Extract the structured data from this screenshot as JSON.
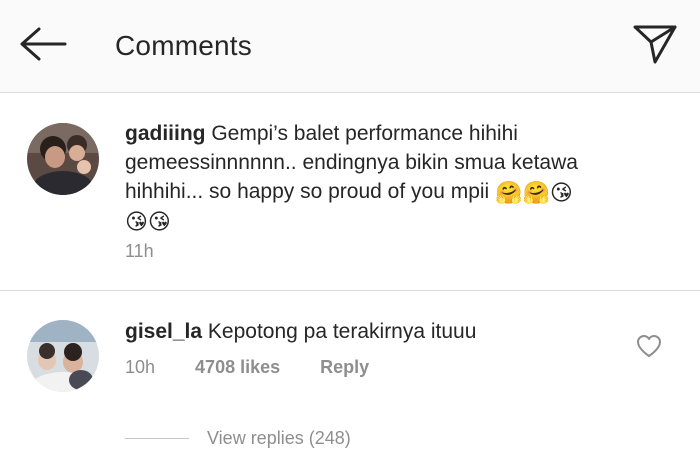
{
  "header": {
    "title": "Comments",
    "back_icon": "arrow-left-icon",
    "send_icon": "paper-plane-icon"
  },
  "caption": {
    "username": "gadiiing",
    "text_line1": " Gempi’s balet performance hihihi",
    "text_line2": "gemeessinnnnnn.. endingnya bikin smua ketawa",
    "text_line3": "hihhihi... so happy so proud of you mpii ",
    "emojis_line3": "🤗🤗😘",
    "emojis_line4": "😘😘",
    "time": "11h"
  },
  "comments": [
    {
      "username": "gisel_la",
      "text": " Kepotong pa terakirnya ituuu",
      "time": "10h",
      "likes": "4708 likes",
      "reply_label": "Reply",
      "like_icon": "heart-outline-icon",
      "view_replies": "View replies (248)"
    }
  ],
  "colors": {
    "primary_text": "#262626",
    "secondary_text": "#8e8e8e",
    "divider": "#dbdbdb",
    "header_bg": "#fafafa"
  }
}
